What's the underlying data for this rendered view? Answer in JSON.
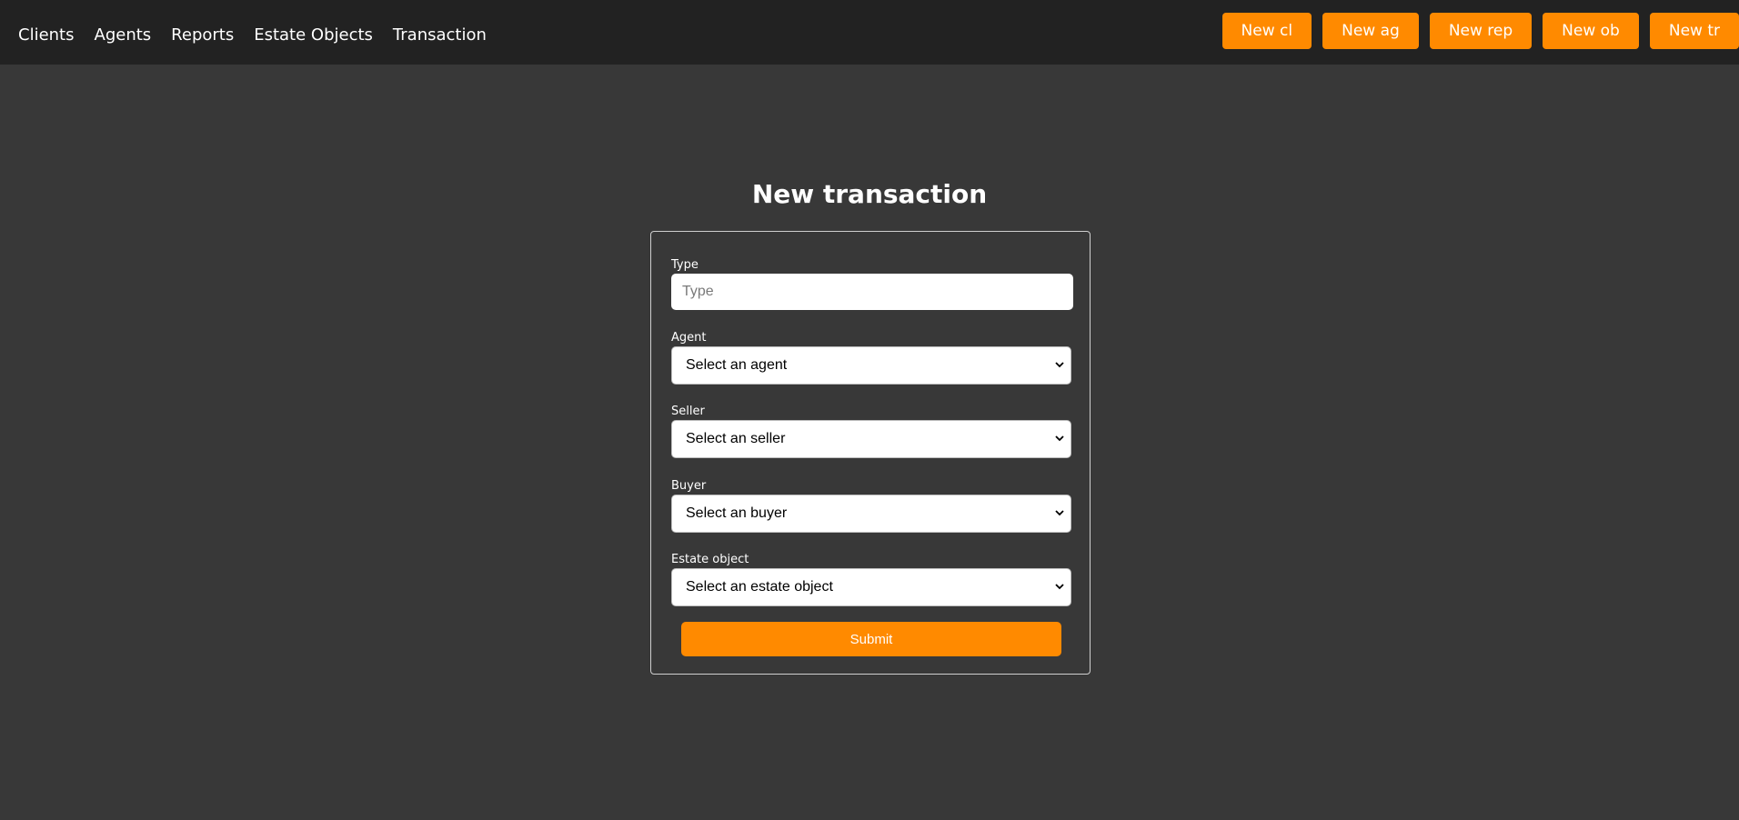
{
  "nav": {
    "links": [
      "Clients",
      "Agents",
      "Reports",
      "Estate Objects",
      "Transaction"
    ],
    "buttons": [
      "New cl",
      "New ag",
      "New rep",
      "New ob",
      "New tr"
    ]
  },
  "page": {
    "title": "New transaction"
  },
  "form": {
    "type_label": "Type",
    "type_placeholder": "Type",
    "type_value": "",
    "agent_label": "Agent",
    "agent_selected": "Select an agent",
    "seller_label": "Seller",
    "seller_selected": "Select an seller",
    "buyer_label": "Buyer",
    "buyer_selected": "Select an buyer",
    "estate_label": "Estate object",
    "estate_selected": "Select an estate object",
    "submit_label": "Submit"
  },
  "colors": {
    "accent": "#ff8a00",
    "navbar_bg": "#222222",
    "page_bg": "#383838"
  }
}
